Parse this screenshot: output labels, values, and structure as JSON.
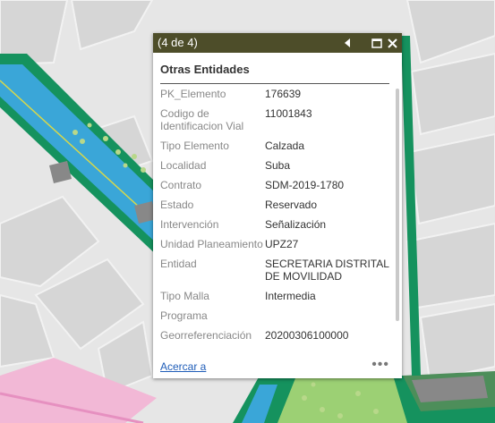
{
  "popup": {
    "title": "(4 de 4)",
    "layer_title": "Otras Entidades",
    "attributes": [
      {
        "key": "PK_Elemento",
        "value": "176639"
      },
      {
        "key": "Codigo de Identificacion Vial",
        "value": "11001843"
      },
      {
        "key": "Tipo Elemento",
        "value": "Calzada"
      },
      {
        "key": "Localidad",
        "value": "Suba"
      },
      {
        "key": "Contrato",
        "value": "SDM-2019-1780"
      },
      {
        "key": "Estado",
        "value": "Reservado"
      },
      {
        "key": "Intervención",
        "value": "Señalización"
      },
      {
        "key": "Unidad Planeamiento",
        "value": "UPZ27"
      },
      {
        "key": "Entidad",
        "value": "SECRETARIA DISTRITAL DE MOVILIDAD"
      },
      {
        "key": "Tipo Malla",
        "value": "Intermedia"
      },
      {
        "key": "Programa",
        "value": ""
      },
      {
        "key": "Georreferenciación",
        "value": "20200306100000"
      }
    ],
    "footer": {
      "zoom_label": "Acercar a",
      "more_label": "•••"
    },
    "icons": {
      "prev": "previous-icon",
      "maximize": "maximize-icon",
      "close": "close-icon"
    },
    "colors": {
      "header": "#4d4d29",
      "link": "#1f5db8"
    }
  }
}
